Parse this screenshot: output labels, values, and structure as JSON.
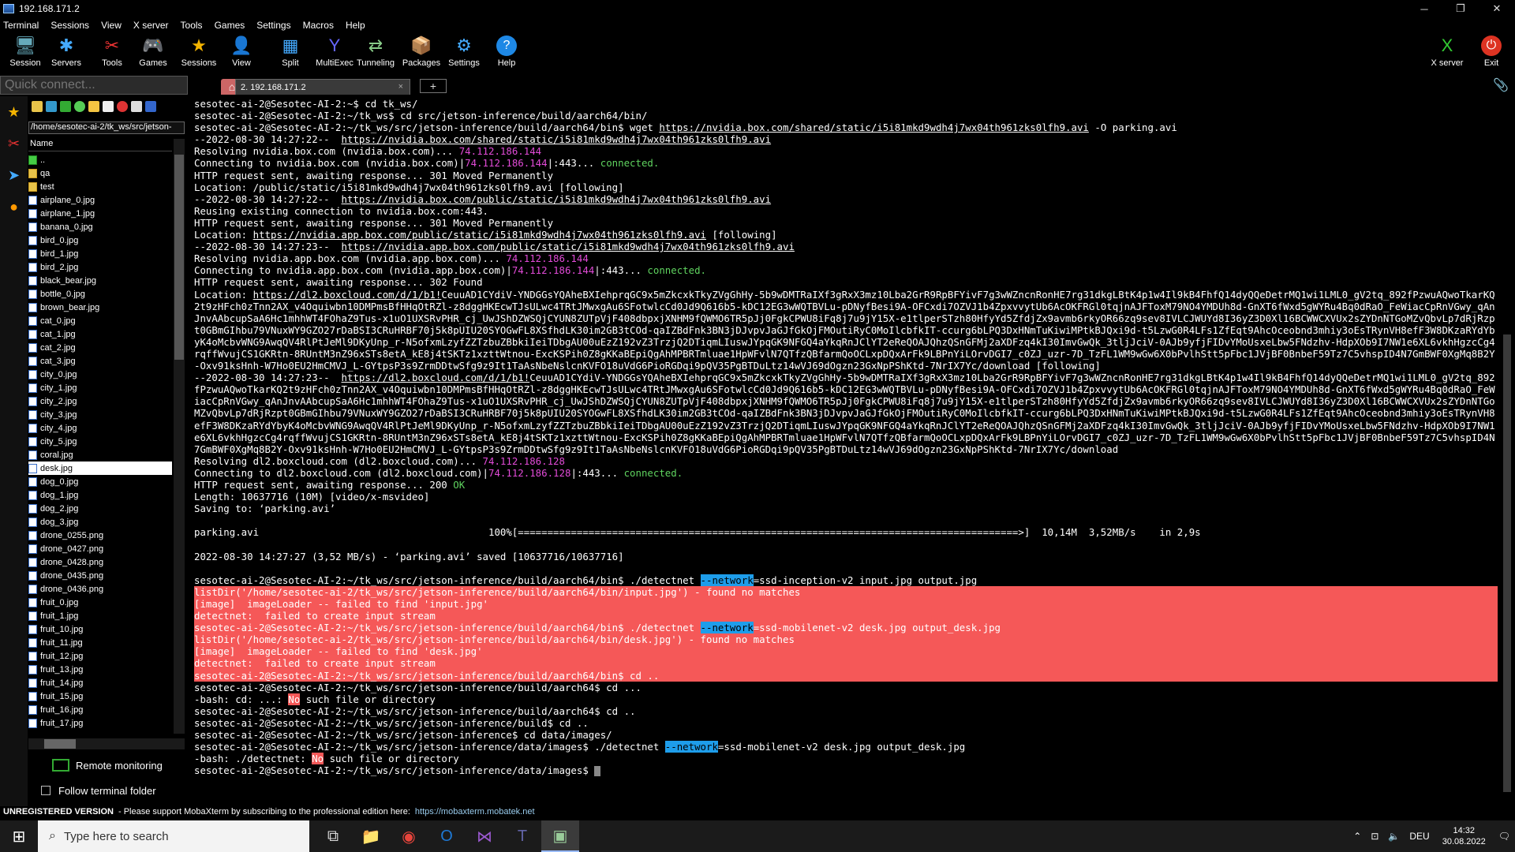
{
  "window": {
    "title": "192.168.171.2",
    "minimize": "─",
    "maximize": "❐",
    "close": "✕"
  },
  "menu": [
    "Terminal",
    "Sessions",
    "View",
    "X server",
    "Tools",
    "Games",
    "Settings",
    "Macros",
    "Help"
  ],
  "toolbar": [
    {
      "label": "Session",
      "icon": "session-icon",
      "glyph": "🖥",
      "color": "#6ab"
    },
    {
      "label": "Servers",
      "icon": "servers-icon",
      "glyph": "✱",
      "color": "#4af"
    },
    {
      "label": "Tools",
      "icon": "tools-icon",
      "glyph": "✂",
      "color": "#e33"
    },
    {
      "label": "Games",
      "icon": "games-icon",
      "glyph": "🎮",
      "color": "#ccc"
    },
    {
      "label": "Sessions",
      "icon": "sessions-star-icon",
      "glyph": "★",
      "color": "#f4b400"
    },
    {
      "label": "View",
      "icon": "view-icon",
      "glyph": "👤",
      "color": "#aaa"
    },
    {
      "label": "Split",
      "icon": "split-icon",
      "glyph": "▦",
      "color": "#4af"
    },
    {
      "label": "MultiExec",
      "icon": "multiexec-icon",
      "glyph": "Y",
      "color": "#66f"
    },
    {
      "label": "Tunneling",
      "icon": "tunneling-icon",
      "glyph": "⇄",
      "color": "#8c8"
    },
    {
      "label": "Packages",
      "icon": "packages-icon",
      "glyph": "📦",
      "color": "#8af"
    },
    {
      "label": "Settings",
      "icon": "settings-icon",
      "glyph": "⚙",
      "color": "#4af"
    },
    {
      "label": "Help",
      "icon": "help-icon",
      "glyph": "?",
      "color": "#fff"
    }
  ],
  "toolbar_right": [
    {
      "label": "X server",
      "icon": "xserver-icon",
      "glyph": "X",
      "color": "#3c3"
    },
    {
      "label": "Exit",
      "icon": "exit-icon",
      "glyph": "⏻",
      "color": "#e33"
    }
  ],
  "quick_connect": {
    "placeholder": "Quick connect..."
  },
  "tabs": {
    "session_label": "2. 192.168.171.2",
    "close": "×",
    "new": "+",
    "home": "⌂"
  },
  "sidebar": {
    "path": "/home/sesotec-ai-2/tk_ws/src/jetson-",
    "column_header": "Name",
    "files": [
      {
        "name": "..",
        "type": "up"
      },
      {
        "name": "qa",
        "type": "folder"
      },
      {
        "name": "test",
        "type": "folder"
      },
      {
        "name": "airplane_0.jpg",
        "type": "file"
      },
      {
        "name": "airplane_1.jpg",
        "type": "file"
      },
      {
        "name": "banana_0.jpg",
        "type": "file"
      },
      {
        "name": "bird_0.jpg",
        "type": "file"
      },
      {
        "name": "bird_1.jpg",
        "type": "file"
      },
      {
        "name": "bird_2.jpg",
        "type": "file"
      },
      {
        "name": "black_bear.jpg",
        "type": "file"
      },
      {
        "name": "bottle_0.jpg",
        "type": "file"
      },
      {
        "name": "brown_bear.jpg",
        "type": "file"
      },
      {
        "name": "cat_0.jpg",
        "type": "file"
      },
      {
        "name": "cat_1.jpg",
        "type": "file"
      },
      {
        "name": "cat_2.jpg",
        "type": "file"
      },
      {
        "name": "cat_3.jpg",
        "type": "file"
      },
      {
        "name": "city_0.jpg",
        "type": "file"
      },
      {
        "name": "city_1.jpg",
        "type": "file"
      },
      {
        "name": "city_2.jpg",
        "type": "file"
      },
      {
        "name": "city_3.jpg",
        "type": "file"
      },
      {
        "name": "city_4.jpg",
        "type": "file"
      },
      {
        "name": "city_5.jpg",
        "type": "file"
      },
      {
        "name": "coral.jpg",
        "type": "file"
      },
      {
        "name": "desk.jpg",
        "type": "file",
        "selected": true
      },
      {
        "name": "dog_0.jpg",
        "type": "file"
      },
      {
        "name": "dog_1.jpg",
        "type": "file"
      },
      {
        "name": "dog_2.jpg",
        "type": "file"
      },
      {
        "name": "dog_3.jpg",
        "type": "file"
      },
      {
        "name": "drone_0255.png",
        "type": "file"
      },
      {
        "name": "drone_0427.png",
        "type": "file"
      },
      {
        "name": "drone_0428.png",
        "type": "file"
      },
      {
        "name": "drone_0435.png",
        "type": "file"
      },
      {
        "name": "drone_0436.png",
        "type": "file"
      },
      {
        "name": "fruit_0.jpg",
        "type": "file"
      },
      {
        "name": "fruit_1.jpg",
        "type": "file"
      },
      {
        "name": "fruit_10.jpg",
        "type": "file"
      },
      {
        "name": "fruit_11.jpg",
        "type": "file"
      },
      {
        "name": "fruit_12.jpg",
        "type": "file"
      },
      {
        "name": "fruit_13.jpg",
        "type": "file"
      },
      {
        "name": "fruit_14.jpg",
        "type": "file"
      },
      {
        "name": "fruit_15.jpg",
        "type": "file"
      },
      {
        "name": "fruit_16.jpg",
        "type": "file"
      },
      {
        "name": "fruit_17.jpg",
        "type": "file"
      }
    ],
    "remote_monitoring": "Remote monitoring",
    "follow_folder": "Follow terminal folder"
  },
  "terminal": {
    "lines": [
      {
        "cls": "",
        "parts": [
          [
            "",
            "sesotec-ai-2@Sesotec-AI-2:~$ cd tk_ws/"
          ]
        ]
      },
      {
        "cls": "",
        "parts": [
          [
            "",
            "sesotec-ai-2@Sesotec-AI-2:~/tk_ws$ cd src/jetson-inference/build/aarch64/bin/"
          ]
        ]
      },
      {
        "cls": "",
        "parts": [
          [
            "",
            "sesotec-ai-2@Sesotec-AI-2:~/tk_ws/src/jetson-inference/build/aarch64/bin$ wget "
          ],
          [
            "u",
            "https://nvidia.box.com/shared/static/i5i81mkd9wdh4j7wx04th961zks0lfh9.avi"
          ],
          [
            "",
            " -O parking.avi"
          ]
        ]
      },
      {
        "cls": "",
        "parts": [
          [
            "",
            "--2022-08-30 14:27:22--  "
          ],
          [
            "u",
            "https://nvidia.box.com/shared/static/i5i81mkd9wdh4j7wx04th961zks0lfh9.avi"
          ]
        ]
      },
      {
        "cls": "",
        "parts": [
          [
            "",
            "Resolving nvidia.box.com (nvidia.box.com)... "
          ],
          [
            "mag",
            "74.112.186.144"
          ]
        ]
      },
      {
        "cls": "",
        "parts": [
          [
            "",
            "Connecting to nvidia.box.com (nvidia.box.com)|"
          ],
          [
            "mag",
            "74.112.186.144"
          ],
          [
            "",
            "|:443... "
          ],
          [
            "grn",
            "connected."
          ]
        ]
      },
      {
        "cls": "",
        "parts": [
          [
            "",
            "HTTP request sent, awaiting response... 301 Moved Permanently"
          ]
        ]
      },
      {
        "cls": "",
        "parts": [
          [
            "",
            "Location: /public/static/i5i81mkd9wdh4j7wx04th961zks0lfh9.avi [following]"
          ]
        ]
      },
      {
        "cls": "",
        "parts": [
          [
            "",
            "--2022-08-30 14:27:22--  "
          ],
          [
            "u",
            "https://nvidia.box.com/public/static/i5i81mkd9wdh4j7wx04th961zks0lfh9.avi"
          ]
        ]
      },
      {
        "cls": "",
        "parts": [
          [
            "",
            "Reusing existing connection to nvidia.box.com:443."
          ]
        ]
      },
      {
        "cls": "",
        "parts": [
          [
            "",
            "HTTP request sent, awaiting response... 301 Moved Permanently"
          ]
        ]
      },
      {
        "cls": "",
        "parts": [
          [
            "",
            "Location: "
          ],
          [
            "u",
            "https://nvidia.app.box.com/public/static/i5i81mkd9wdh4j7wx04th961zks0lfh9.avi"
          ],
          [
            "",
            " [following]"
          ]
        ]
      },
      {
        "cls": "",
        "parts": [
          [
            "",
            "--2022-08-30 14:27:23--  "
          ],
          [
            "u",
            "https://nvidia.app.box.com/public/static/i5i81mkd9wdh4j7wx04th961zks0lfh9.avi"
          ]
        ]
      },
      {
        "cls": "",
        "parts": [
          [
            "",
            "Resolving nvidia.app.box.com (nvidia.app.box.com)... "
          ],
          [
            "mag",
            "74.112.186.144"
          ]
        ]
      },
      {
        "cls": "",
        "parts": [
          [
            "",
            "Connecting to nvidia.app.box.com (nvidia.app.box.com)|"
          ],
          [
            "mag",
            "74.112.186.144"
          ],
          [
            "",
            "|:443... "
          ],
          [
            "grn",
            "connected."
          ]
        ]
      },
      {
        "cls": "",
        "parts": [
          [
            "",
            "HTTP request sent, awaiting response... 302 Found"
          ]
        ]
      },
      {
        "cls": "wrap",
        "parts": [
          [
            "",
            "Location: "
          ],
          [
            "u",
            "https://dl2.boxcloud.com/d/1/b1!"
          ],
          [
            "",
            "CeuuAD1CYdiV-YNDGGsYQAheBXIehprqGC9x5mZkcxkTkyZVgGhHy-5b9wDMTRaIXf3gRxX3mz10Lba2GrR9RpBFYivF7g3wWZncnRonHE7rg31dkgLBtK4p1w4Il9kB4FhfQ14dyQQeDetrMQ1wi1LML0_gV2tq_892fPzwuAQwoTkarKQ2t9zHFch0zTnn2AX_v4Oquiwbn10DMPmsBfHHqOtRZl-z8dggHKEcwTJsULwc4TRtJMwxgAu6SFotwlcCd0Jd9Q616b5-kDC12EG3wWQTBVLu-pDNyfBesi9A-OFCxdi7OZVJ1b4ZpxvvytUb6AcOKFRGl0tqjnAJFToxM79NO4YMDUh8d-GnXT6fWxd5gWYRu4Bq0dRaO_FeWiacCpRnVGwy_qAnJnvAAbcupSaA6Hc1mhhWT4FOhaZ9Tus-x1uO1UXSRvPHR_cj_UwJShDZWSQjCYUN8ZUTpVjF408dbpxjXNHM9fQWMO6TR5pJj0FgkCPWU8iFq8j7u9jY15X-e1tlperSTzh80HfyYd5ZfdjZx9avmb6rkyOR66zq9sev8IVLCJWUYd8I36yZ3D0Xl16BCWWCXVUx2sZYDnNTGoMZvQbvLp7dRjRzpt0GBmGIhbu79VNuxWY9GZO27rDaBSI3CRuHRBF70j5k8pUIU20SYOGwFL8XSfhdLK30im2GB3tCOd-qaIZBdFnk3BN3jDJvpvJaGJfGkOjFMOutiRyC0MoIlcbfkIT-ccurg6bLPQ3DxHNmTuKiwiMPtkBJQxi9d-t5LzwG0R4LFs1ZfEqt9AhcOceobnd3mhiy3oEsTRynVH8efF3W8DKzaRYdYbyK4oMcbvWNG9AwqQV4RlPtJeMl9DKyUnp_r-N5ofxmLzyfZZTzbuZBbkiIeiTDbgAU00uEzZ192vZ3TrzjQ2DTiqmLIuswJYpqGK9NFGQ4aYkqRnJClYT2eReQOAJQhzQSnGFMj2aXDFzq4kI30ImvGwQk_3tljJciV-0AJb9yfjFIDvYMoUsxeLbw5FNdzhv-HdpXOb9I7NW1e6XL6vkhHgzcCg4rqffWvujCS1GKRtn-8RUntM3nZ96xSTs8etA_kE8j4tSKTz1xzttWtnou-ExcKSPih0Z8gKKaBEpiQgAhMPBRTmluae1HpWFvlN7QTfzQBfarmQoOCLxpDQxArFk9LBPnYiLOrvDGI7_c0ZJ_uzr-7D_TzFL1WM9wGw6X0bPvlhStt5pFbc1JVjBF0BnbeF59Tz7C5vhspID4N7GmBWF0XgMq8B2Y-Oxv91ksHnh-W7Ho0EU2HmCMVJ_L-GYtpsP3s9ZrmDDtwSfg9z9It1TaAsNbeNslcnKVFO18uVdG6PioRGDqi9pQV35PgBTDuLtz14wVJ69dOgzn23GxNpPShKtd-7NrIX7Yc/download [following]"
          ]
        ]
      },
      {
        "cls": "wrap",
        "parts": [
          [
            "",
            "--2022-08-30 14:27:23--  "
          ],
          [
            "u",
            "https://dl2.boxcloud.com/d/1/b1!"
          ],
          [
            "",
            "CeuuAD1CYdiV-YNDGGsYQAheBXIehprqGC9x5mZkcxkTkyZVgGhHy-5b9wDMTRaIXf3gRxX3mz10Lba2GrR9RpBFYivF7g3wWZncnRonHE7rg31dkgLBtK4p1w4Il9kB4FhfQ14dyQQeDetrMQ1wi1LML0_gV2tq_892fPzwuAQwoTkarKQ2t9zHFch0zTnn2AX_v4Oquiwbn10DMPmsBfHHqOtRZl-z8dggHKEcwTJsULwc4TRtJMwxgAu6SFotwlcCd0Jd9Q616b5-kDC12EG3wWQTBVLu-pDNyfBesi9A-OFCxdi7OZVJ1b4ZpxvvytUb6AcOKFRGl0tqjnAJFToxM79NO4YMDUh8d-GnXT6fWxd5gWYRu4Bq0dRaO_FeWiacCpRnVGwy_qAnJnvAAbcupSaA6Hc1mhhWT4FOhaZ9Tus-x1uO1UXSRvPHR_cj_UwJShDZWSQjCYUN8ZUTpVjF408dbpxjXNHM9fQWMO6TR5pJj0FgkCPWU8iFq8j7u9jY15X-e1tlperSTzh80HfyYd5ZfdjZx9avmb6rkyOR66zq9sev8IVLCJWUYd8I36yZ3D0Xl16BCWWCXVUx2sZYDnNTGoMZvQbvLp7dRjRzpt0GBmGIhbu79VNuxWY9GZO27rDaBSI3CRuHRBF70j5k8pUIU20SYOGwFL8XSfhdLK30im2GB3tCOd-qaIZBdFnk3BN3jDJvpvJaGJfGkOjFMOutiRyC0MoIlcbfkIT-ccurg6bLPQ3DxHNmTuKiwiMPtkBJQxi9d-t5LzwG0R4LFs1ZfEqt9AhcOceobnd3mhiy3oEsTRynVH8efF3W8DKzaRYdYbyK4oMcbvWNG9AwqQV4RlPtJeMl9DKyUnp_r-N5ofxmLzyfZZTzbuZBbkiIeiTDbgAU00uEzZ192vZ3TrzjQ2DTiqmLIuswJYpqGK9NFGQ4aYkqRnJClYT2eReQOAJQhzQSnGFMj2aXDFzq4kI30ImvGwQk_3tljJciV-0AJb9yfjFIDvYMoUsxeLbw5FNdzhv-HdpXOb9I7NW1e6XL6vkhHgzcCg4rqffWvujCS1GKRtn-8RUntM3nZ96xSTs8etA_kE8j4tSKTz1xzttWtnou-ExcKSPih0Z8gKKaBEpiQgAhMPBRTmluae1HpWFvlN7QTfzQBfarmQoOCLxpDQxArFk9LBPnYiLOrvDGI7_c0ZJ_uzr-7D_TzFL1WM9wGw6X0bPvlhStt5pFbc1JVjBF0BnbeF59Tz7C5vhspID4N7GmBWF0XgMq8B2Y-Oxv91ksHnh-W7Ho0EU2HmCMVJ_L-GYtpsP3s9ZrmDDtwSfg9z9It1TaAsNbeNslcnKVFO18uVdG6PioRGDqi9pQV35PgBTDuLtz14wVJ69dOgzn23GxNpPShKtd-7NrIX7Yc/download"
          ]
        ]
      },
      {
        "cls": "",
        "parts": [
          [
            "",
            "Resolving dl2.boxcloud.com (dl2.boxcloud.com)... "
          ],
          [
            "mag",
            "74.112.186.128"
          ]
        ]
      },
      {
        "cls": "",
        "parts": [
          [
            "",
            "Connecting to dl2.boxcloud.com (dl2.boxcloud.com)|"
          ],
          [
            "mag",
            "74.112.186.128"
          ],
          [
            "",
            "|:443... "
          ],
          [
            "grn",
            "connected."
          ]
        ]
      },
      {
        "cls": "",
        "parts": [
          [
            "",
            "HTTP request sent, awaiting response... 200 "
          ],
          [
            "grn",
            "OK"
          ]
        ]
      },
      {
        "cls": "",
        "parts": [
          [
            "",
            "Length: 10637716 (10M) [video/x-msvideo]"
          ]
        ]
      },
      {
        "cls": "",
        "parts": [
          [
            "",
            "Saving to: ‘parking.avi’"
          ]
        ]
      },
      {
        "cls": "",
        "parts": [
          [
            "",
            ""
          ]
        ]
      },
      {
        "cls": "",
        "parts": [
          [
            "",
            "parking.avi                                       100%[=====================================================================================>]  10,14M  3,52MB/s    in 2,9s"
          ]
        ]
      },
      {
        "cls": "",
        "parts": [
          [
            "",
            ""
          ]
        ]
      },
      {
        "cls": "",
        "parts": [
          [
            "",
            "2022-08-30 14:27:27 (3,52 MB/s) - ‘parking.avi’ saved [10637716/10637716]"
          ]
        ]
      },
      {
        "cls": "",
        "parts": [
          [
            "",
            ""
          ]
        ]
      },
      {
        "cls": "",
        "parts": [
          [
            "",
            "sesotec-ai-2@Sesotec-AI-2:~/tk_ws/src/jetson-inference/build/aarch64/bin$ ./detectnet "
          ],
          [
            "hl",
            "--network"
          ],
          [
            "",
            "=ssd-inception-v2 input.jpg output.jpg"
          ]
        ]
      },
      {
        "cls": "red",
        "parts": [
          [
            "",
            "listDir('/home/sesotec-ai-2/tk_ws/src/jetson-inference/build/aarch64/bin/input.jpg') - found no matches"
          ]
        ]
      },
      {
        "cls": "red",
        "parts": [
          [
            "",
            "[image]  imageLoader -- failed to find 'input.jpg'"
          ]
        ]
      },
      {
        "cls": "red",
        "parts": [
          [
            "",
            "detectnet:  failed to create input stream"
          ]
        ]
      },
      {
        "cls": "red",
        "parts": [
          [
            "",
            "sesotec-ai-2@Sesotec-AI-2:~/tk_ws/src/jetson-inference/build/aarch64/bin$ ./detectnet "
          ],
          [
            "hl",
            "--network"
          ],
          [
            "",
            "=ssd-mobilenet-v2 desk.jpg output_desk.jpg"
          ]
        ]
      },
      {
        "cls": "red",
        "parts": [
          [
            "",
            "listDir('/home/sesotec-ai-2/tk_ws/src/jetson-inference/build/aarch64/bin/desk.jpg') - found no matches"
          ]
        ]
      },
      {
        "cls": "red",
        "parts": [
          [
            "",
            "[image]  imageLoader -- failed to find 'desk.jpg'"
          ]
        ]
      },
      {
        "cls": "red",
        "parts": [
          [
            "",
            "detectnet:  failed to create input stream"
          ]
        ]
      },
      {
        "cls": "red",
        "parts": [
          [
            "",
            "sesotec-ai-2@Sesotec-AI-2:~/tk_ws/src/jetson-inference/build/aarch64/bin$ cd .."
          ]
        ]
      },
      {
        "cls": "",
        "parts": [
          [
            "",
            "sesotec-ai-2@Sesotec-AI-2:~/tk_ws/src/jetson-inference/build/aarch64$ cd ..."
          ]
        ]
      },
      {
        "cls": "",
        "parts": [
          [
            "",
            "-bash: cd: ...: "
          ],
          [
            "red",
            "No"
          ],
          [
            "",
            " such file or directory"
          ]
        ]
      },
      {
        "cls": "",
        "parts": [
          [
            "",
            "sesotec-ai-2@Sesotec-AI-2:~/tk_ws/src/jetson-inference/build/aarch64$ cd .."
          ]
        ]
      },
      {
        "cls": "",
        "parts": [
          [
            "",
            "sesotec-ai-2@Sesotec-AI-2:~/tk_ws/src/jetson-inference/build$ cd .."
          ]
        ]
      },
      {
        "cls": "",
        "parts": [
          [
            "",
            "sesotec-ai-2@Sesotec-AI-2:~/tk_ws/src/jetson-inference$ cd data/images/"
          ]
        ]
      },
      {
        "cls": "",
        "parts": [
          [
            "",
            "sesotec-ai-2@Sesotec-AI-2:~/tk_ws/src/jetson-inference/data/images$ ./detectnet "
          ],
          [
            "hl",
            "--network"
          ],
          [
            "",
            "=ssd-mobilenet-v2 desk.jpg output_desk.jpg"
          ]
        ]
      },
      {
        "cls": "",
        "parts": [
          [
            "",
            "-bash: ./detectnet: "
          ],
          [
            "red",
            "No"
          ],
          [
            "",
            " such file or directory"
          ]
        ]
      },
      {
        "cls": "",
        "parts": [
          [
            "",
            "sesotec-ai-2@Sesotec-AI-2:~/tk_ws/src/jetson-inference/data/images$ "
          ]
        ]
      }
    ]
  },
  "status": {
    "unregistered": "UNREGISTERED VERSION",
    "message": "-  Please support MobaXterm by subscribing to the professional edition here:",
    "link": "https://mobaxterm.mobatek.net"
  },
  "taskbar": {
    "search_placeholder": "Type here to search",
    "apps": [
      {
        "name": "task-view-icon",
        "glyph": "⧉",
        "color": "#ddd"
      },
      {
        "name": "file-explorer-icon",
        "glyph": "📁",
        "color": "#f4c542"
      },
      {
        "name": "chrome-icon",
        "glyph": "◉",
        "color": "#e8453c"
      },
      {
        "name": "outlook-icon",
        "glyph": "O",
        "color": "#1e78d4"
      },
      {
        "name": "visual-studio-icon",
        "glyph": "⋈",
        "color": "#9b59d0"
      },
      {
        "name": "teams-icon",
        "glyph": "T",
        "color": "#6264a7"
      },
      {
        "name": "mobaxterm-icon",
        "glyph": "▣",
        "color": "#9c9"
      }
    ],
    "lang": "DEU",
    "time": "14:32",
    "date": "30.08.2022"
  }
}
